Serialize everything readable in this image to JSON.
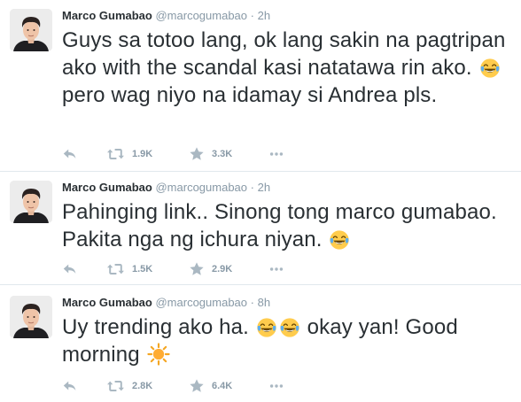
{
  "tweets": [
    {
      "author": "Marco Gumabao",
      "handle": "@marcogumabao",
      "separator": "·",
      "time": "2h",
      "text_parts": [
        "Guys sa totoo lang, ok lang sakin na pagtripan ako with the scandal kasi natatawa rin ako.",
        "pero wag niyo na idamay si Andrea pls."
      ],
      "emoji": [
        "face-with-tears-of-joy"
      ],
      "retweets": "1.9K",
      "favorites": "3.3K"
    },
    {
      "author": "Marco Gumabao",
      "handle": "@marcogumabao",
      "separator": "·",
      "time": "2h",
      "text_parts": [
        "Pahinging link.. Sinong tong marco gumabao. Pakita nga ng ichura niyan.",
        ""
      ],
      "emoji": [
        "face-with-tears-of-joy"
      ],
      "retweets": "1.5K",
      "favorites": "2.9K"
    },
    {
      "author": "Marco Gumabao",
      "handle": "@marcogumabao",
      "separator": "·",
      "time": "8h",
      "text_parts": [
        "Uy trending ako ha.",
        "okay yan! Good morning",
        ""
      ],
      "emoji": [
        "face-with-tears-of-joy",
        "face-with-tears-of-joy",
        "sun"
      ],
      "retweets": "2.8K",
      "favorites": "6.4K"
    }
  ],
  "colors": {
    "name": "#292f33",
    "meta": "#8899a6",
    "icon": "#aab8c2",
    "divider": "#e1e8ed",
    "emoji_face": "#ffcc4d",
    "emoji_tears": "#5dadec",
    "sun": "#f4a623"
  },
  "icons": [
    "reply-icon",
    "retweet-icon",
    "favorite-star-icon",
    "more-options-icon"
  ]
}
